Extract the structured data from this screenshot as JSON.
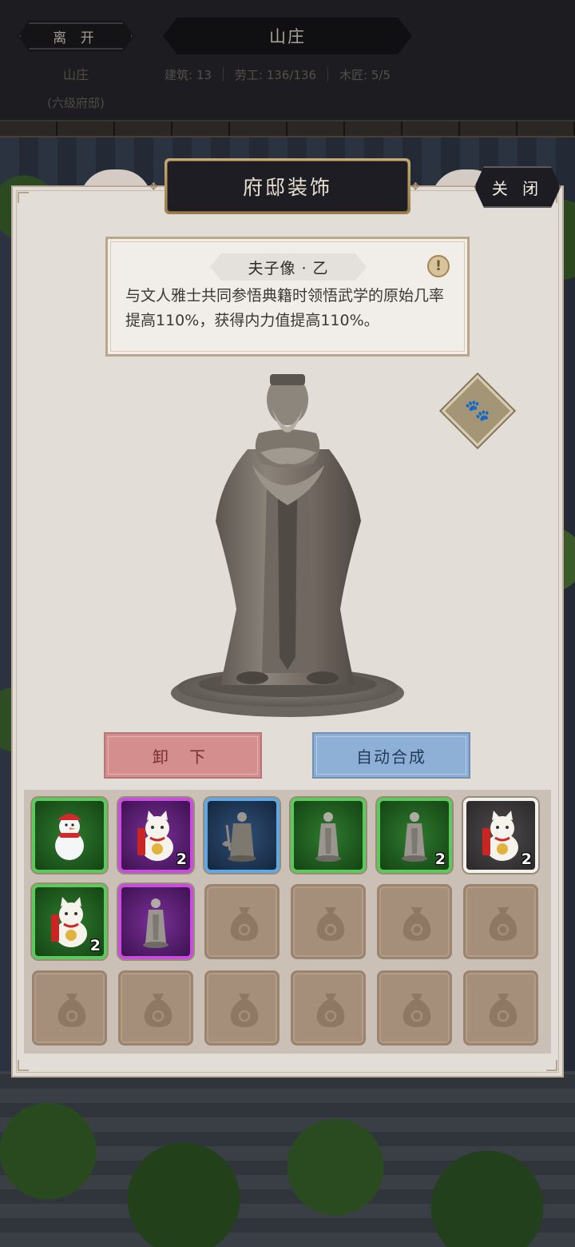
{
  "header": {
    "leave_label": "离 开",
    "title": "山庄",
    "estate_name": "山庄",
    "estate_level": "(六级府邸)",
    "stats": [
      {
        "label": "建筑: 13"
      },
      {
        "label": "劳工: 136/136"
      },
      {
        "label": "木匠: 5/5"
      }
    ]
  },
  "dialog": {
    "title": "府邸装饰",
    "close_label": "关 闭"
  },
  "decoration": {
    "name": "夫子像 · 乙",
    "info_icon": "exclamation-icon",
    "description": "与文人雅士共同参悟典籍时领悟武学的原始几率提高110%，获得内力值提高110%。",
    "pet_icon": "paw-icon"
  },
  "actions": {
    "unload_label": "卸 下",
    "auto_merge_label": "自动合成"
  },
  "inventory": {
    "slots": [
      {
        "item": "snowman-icon",
        "rarity": "green",
        "count": ""
      },
      {
        "item": "lucky-cat-icon",
        "rarity": "purple",
        "count": "2"
      },
      {
        "item": "warrior-statue-icon",
        "rarity": "blue",
        "count": ""
      },
      {
        "item": "scholar-statue-icon",
        "rarity": "green",
        "count": ""
      },
      {
        "item": "scholar-statue-icon",
        "rarity": "green",
        "count": "2"
      },
      {
        "item": "lucky-cat-icon",
        "rarity": "white",
        "count": "2"
      },
      {
        "item": "lucky-cat-icon",
        "rarity": "green",
        "count": "2"
      },
      {
        "item": "scholar-statue-icon",
        "rarity": "purple",
        "count": ""
      },
      {
        "item": "money-bag-icon",
        "rarity": "empty",
        "count": ""
      },
      {
        "item": "money-bag-icon",
        "rarity": "empty",
        "count": ""
      },
      {
        "item": "money-bag-icon",
        "rarity": "empty",
        "count": ""
      },
      {
        "item": "money-bag-icon",
        "rarity": "empty",
        "count": ""
      },
      {
        "item": "money-bag-icon",
        "rarity": "empty",
        "count": ""
      },
      {
        "item": "money-bag-icon",
        "rarity": "empty",
        "count": ""
      },
      {
        "item": "money-bag-icon",
        "rarity": "empty",
        "count": ""
      },
      {
        "item": "money-bag-icon",
        "rarity": "empty",
        "count": ""
      },
      {
        "item": "money-bag-icon",
        "rarity": "empty",
        "count": ""
      },
      {
        "item": "money-bag-icon",
        "rarity": "empty",
        "count": ""
      }
    ]
  },
  "colors": {
    "green_border": "#5bc95b",
    "purple_border": "#c94ce0",
    "blue_border": "#5ea8e8",
    "white_border": "#f2f0ec",
    "unload_button": "#d58e8e",
    "auto_button": "#8fb0d6"
  }
}
